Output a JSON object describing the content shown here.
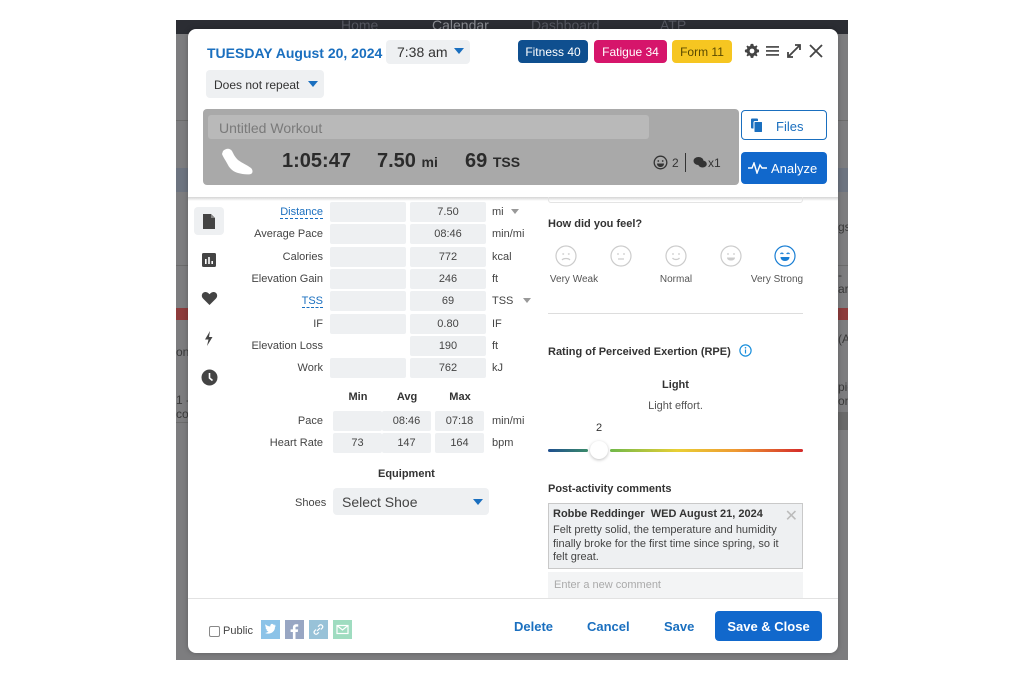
{
  "background": {
    "nav": [
      "Home",
      "Calendar",
      "Dashboard",
      "ATP"
    ],
    "fragments_left": [
      "on",
      "1 -",
      "cor"
    ],
    "fragments_right": [
      "gs",
      "-",
      "arl.",
      "(A",
      "pic",
      "on"
    ]
  },
  "header": {
    "date": "TUESDAY August 20, 2024",
    "time": "7:38 am",
    "repeat": "Does not repeat",
    "badges": [
      {
        "label": "Fitness 40",
        "color": "#0f4f8f",
        "text_color": "#ffffff"
      },
      {
        "label": "Fatigue 34",
        "color": "#d6156b",
        "text_color": "#ffffff"
      },
      {
        "label": "Form 11",
        "color": "#f6c621",
        "text_color": "#5a4a00"
      }
    ],
    "icons": [
      "gear-icon",
      "menu-icon",
      "expand-icon",
      "close-icon"
    ]
  },
  "summary": {
    "title_placeholder": "Untitled Workout",
    "sport_icon": "run-shoe-icon",
    "duration": "1:05:47",
    "distance_value": "7.50",
    "distance_unit": "mi",
    "tss_value": "69",
    "tss_unit": "TSS",
    "feeling_count": "2",
    "comment_count": "x1"
  },
  "actions": {
    "files": "Files",
    "analyze": "Analyze"
  },
  "sidebar": {
    "items": [
      {
        "name": "summary",
        "icon": "document-icon",
        "active": true
      },
      {
        "name": "chart",
        "icon": "bar-chart-icon",
        "active": false
      },
      {
        "name": "heart",
        "icon": "heart-icon",
        "active": false
      },
      {
        "name": "power",
        "icon": "lightning-icon",
        "active": false
      },
      {
        "name": "time",
        "icon": "clock-icon",
        "active": false
      }
    ]
  },
  "metrics": [
    {
      "label": "Distance",
      "planned": "",
      "completed": "7.50",
      "unit": "mi",
      "link": true,
      "dropdown": true
    },
    {
      "label": "Average Pace",
      "planned": "",
      "completed": "08:46",
      "unit": "min/mi",
      "link": false,
      "dropdown": false
    },
    {
      "label": "Calories",
      "planned": "",
      "completed": "772",
      "unit": "kcal",
      "link": false,
      "dropdown": false
    },
    {
      "label": "Elevation Gain",
      "planned": "",
      "completed": "246",
      "unit": "ft",
      "link": false,
      "dropdown": false
    },
    {
      "label": "TSS",
      "planned": "",
      "completed": "69",
      "unit": "TSS",
      "link": true,
      "dropdown": true
    },
    {
      "label": "IF",
      "planned": "",
      "completed": "0.80",
      "unit": "IF",
      "link": false,
      "dropdown": false
    },
    {
      "label": "Elevation Loss",
      "planned": null,
      "completed": "190",
      "unit": "ft",
      "link": false,
      "dropdown": false
    },
    {
      "label": "Work",
      "planned": "",
      "completed": "762",
      "unit": "kJ",
      "link": false,
      "dropdown": false
    }
  ],
  "minmax": {
    "headers": [
      "Min",
      "Avg",
      "Max"
    ],
    "rows": [
      {
        "label": "Pace",
        "min": "",
        "avg": "08:46",
        "max": "07:18",
        "unit": "min/mi"
      },
      {
        "label": "Heart Rate",
        "min": "73",
        "avg": "147",
        "max": "164",
        "unit": "bpm"
      }
    ]
  },
  "equipment": {
    "title": "Equipment",
    "shoes_label": "Shoes",
    "shoes_value": "Select Shoe"
  },
  "feel": {
    "title": "How did you feel?",
    "options": [
      "Very Weak",
      "",
      "Normal",
      "",
      "Very Strong"
    ],
    "selected_index": 4
  },
  "rpe": {
    "title": "Rating of Perceived Exertion (RPE)",
    "level": "Light",
    "description": "Light effort.",
    "value": "2",
    "scale_max": 10,
    "fraction": 0.2
  },
  "comments": {
    "title": "Post-activity comments",
    "items": [
      {
        "author": "Robbe Reddinger",
        "date": "WED August 21, 2024",
        "text": "Felt pretty solid, the temperature and humidity finally broke for the first time since spring, so it felt great."
      }
    ],
    "new_placeholder": "Enter a new comment"
  },
  "footer": {
    "public_label": "Public",
    "share": [
      {
        "name": "twitter",
        "color": "#8cc3e8"
      },
      {
        "name": "facebook",
        "color": "#98a6c3"
      },
      {
        "name": "link",
        "color": "#98c2d8"
      },
      {
        "name": "email",
        "color": "#9fdcc0"
      }
    ],
    "delete": "Delete",
    "cancel": "Cancel",
    "save": "Save",
    "save_close": "Save & Close"
  }
}
